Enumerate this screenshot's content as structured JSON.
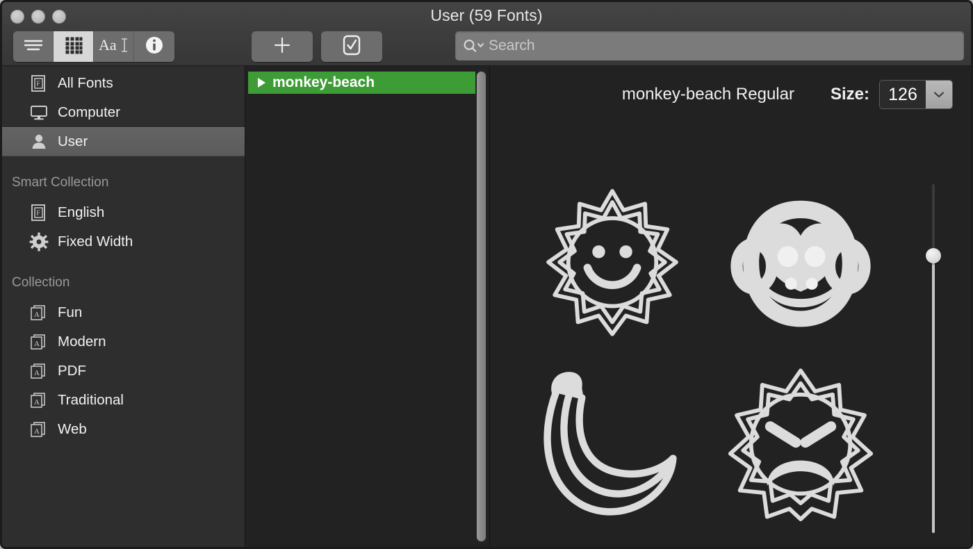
{
  "window": {
    "title": "User (59 Fonts)",
    "traffic_lights": [
      "close-button",
      "minimize-button",
      "zoom-button"
    ]
  },
  "toolbar": {
    "view_modes": [
      {
        "name": "list-view",
        "icon": "list-icon",
        "active": false
      },
      {
        "name": "grid-view",
        "icon": "grid-icon",
        "active": true
      },
      {
        "name": "sample-view",
        "icon": "aa-text-icon",
        "label": "Aa",
        "active": false
      },
      {
        "name": "info-view",
        "icon": "info-circle-icon",
        "active": false
      }
    ],
    "add_label": "+",
    "add_name": "add-font-button",
    "validate_name": "validate-font-button",
    "validate_icon": "checkbox-checked-icon"
  },
  "search": {
    "placeholder": "Search",
    "value": "",
    "icon": "search-magnifier-icon"
  },
  "sidebar": {
    "items": [
      {
        "label": "All Fonts",
        "icon": "font-book-icon",
        "selected": false
      },
      {
        "label": "Computer",
        "icon": "computer-display-icon",
        "selected": false
      },
      {
        "label": "User",
        "icon": "user-person-icon",
        "selected": true
      }
    ],
    "groups": [
      {
        "header": "Smart Collection",
        "items": [
          {
            "label": "English",
            "icon": "font-book-icon"
          },
          {
            "label": "Fixed Width",
            "icon": "gear-icon"
          }
        ]
      },
      {
        "header": "Collection",
        "items": [
          {
            "label": "Fun",
            "icon": "font-stack-icon"
          },
          {
            "label": "Modern",
            "icon": "font-stack-icon"
          },
          {
            "label": "PDF",
            "icon": "font-stack-icon"
          },
          {
            "label": "Traditional",
            "icon": "font-stack-icon"
          },
          {
            "label": "Web",
            "icon": "font-stack-icon"
          }
        ]
      }
    ]
  },
  "font_list": {
    "rows": [
      {
        "label": "monkey-beach",
        "selected": true,
        "expanded": false,
        "disclosure": "disclosure-triangle-right-icon"
      }
    ],
    "selection_color": "#3d9c35"
  },
  "preview": {
    "font_name": "monkey-beach Regular",
    "size_label": "Size:",
    "size_value": "126",
    "size_chevron": "chevron-down-icon",
    "glyphs": [
      {
        "name": "smiling-sun-glyph"
      },
      {
        "name": "monkey-face-glyph"
      },
      {
        "name": "banana-glyph"
      },
      {
        "name": "angry-sun-glyph"
      }
    ],
    "slider_name": "size-slider"
  },
  "colors": {
    "window_bg": "#2b2b2b",
    "sidebar_bg": "#2e2e2e",
    "content_bg": "#222222",
    "titlebar_bg": "#3c3c3c",
    "accent_green": "#3d9c35",
    "text_primary": "#f2f2f2",
    "text_secondary": "#9a9a9a",
    "glyph_fill": "#dcdcdc"
  }
}
